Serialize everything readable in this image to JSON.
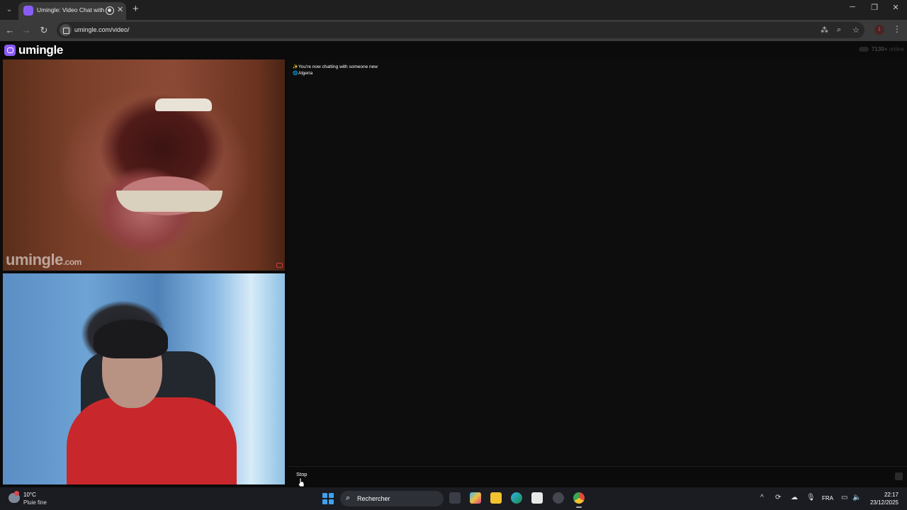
{
  "browser": {
    "tab_title": "Umingle: Video Chat with S",
    "url": "umingle.com/video/",
    "new_tab_symbol": "+",
    "tab_close_symbol": "✕"
  },
  "site": {
    "logo_text": "umingle",
    "online_count": "7130+",
    "online_label": "online",
    "watermark_main": "umingle",
    "watermark_suffix": ".com"
  },
  "chat": {
    "messages": [
      {
        "icon": "sparkles-icon",
        "text": "You're now chatting with someone new"
      },
      {
        "icon": "globe-icon",
        "text": "Algeria"
      }
    ],
    "stop_label": "Stop"
  },
  "taskbar": {
    "weather_temp": "10°C",
    "weather_desc": "Pluie fine",
    "search_label": "Rechercher",
    "language": "FRA",
    "time": "22:17",
    "date": "23/12/2025"
  },
  "colors": {
    "brand": "#8a5cf6",
    "page_bg": "#0b0b0b",
    "taskbar_bg": "#1a1c22"
  }
}
